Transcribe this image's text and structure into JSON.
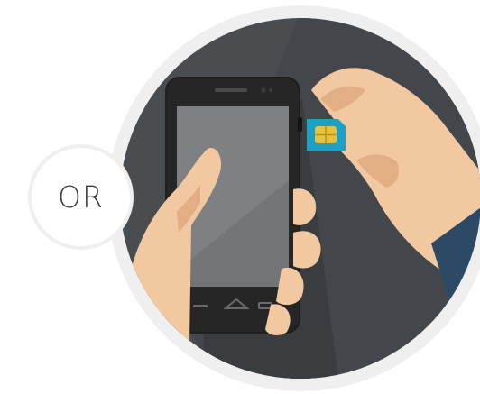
{
  "badge": {
    "label": "OR"
  },
  "colors": {
    "ring": "#efefef",
    "background_dark": "#4a4d50",
    "background_shade": "#3f4245",
    "phone_body": "#1f1f1f",
    "phone_screen": "#6f7173",
    "skin": "#f2c8a0",
    "skin_shadow": "#e2ae84",
    "sleeve": "#2c4a66",
    "sim_card": "#1e9fc4",
    "sim_chip": "#e8c23a"
  },
  "icons": [
    "phone-icon",
    "sim-card-icon",
    "hand-icon"
  ]
}
